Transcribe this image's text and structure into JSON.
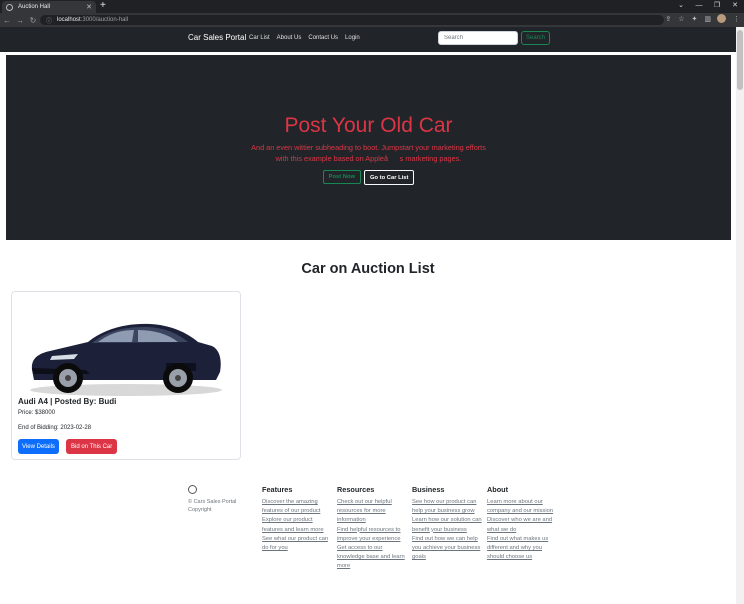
{
  "browser": {
    "tab_title": "Auction Hall",
    "new_tab": "+",
    "url_host": "localhost",
    "url_path": ":3000/auction-hall"
  },
  "navbar": {
    "brand": "Car Sales Portal",
    "links": [
      "Car List",
      "About Us",
      "Contact Us",
      "Login"
    ],
    "search_placeholder": "Search",
    "search_button": "Search"
  },
  "hero": {
    "title": "Post Your Old Car",
    "subtitle": "And an even wittier subheading to boot. Jumpstart your marketing efforts with this example based on Appleâs marketing pages.",
    "post_button": "Post Now",
    "list_button": "Go to Car List"
  },
  "section": {
    "title": "Car on Auction List"
  },
  "cards": [
    {
      "title": "Audi A4 | Posted By: Budi",
      "price": "Price: $38000",
      "end": "End of Bidding: 2023-02-28",
      "view_button": "View Details",
      "bid_button": "Bid on This Car"
    }
  ],
  "footer": {
    "copyright": "© Cars Sales Portal Copyright",
    "columns": [
      {
        "heading": "Features",
        "links": [
          "Discover the amazing features of our product",
          "Explore our product features and learn more",
          "See what our product can do for you"
        ]
      },
      {
        "heading": "Resources",
        "links": [
          "Check out our helpful resources for more information",
          "Find helpful resources to improve your experience",
          "Get access to our knowledge base and learn more"
        ]
      },
      {
        "heading": "Business",
        "links": [
          "See how our product can help your business grow",
          "Learn how our solution can benefit your business",
          "Find out how we can help you achieve your business goals"
        ]
      },
      {
        "heading": "About",
        "links": [
          "Learn more about our company and our mission",
          "Discover who we are and what we do",
          "Find out what makes us different and why you should choose us"
        ]
      }
    ]
  }
}
